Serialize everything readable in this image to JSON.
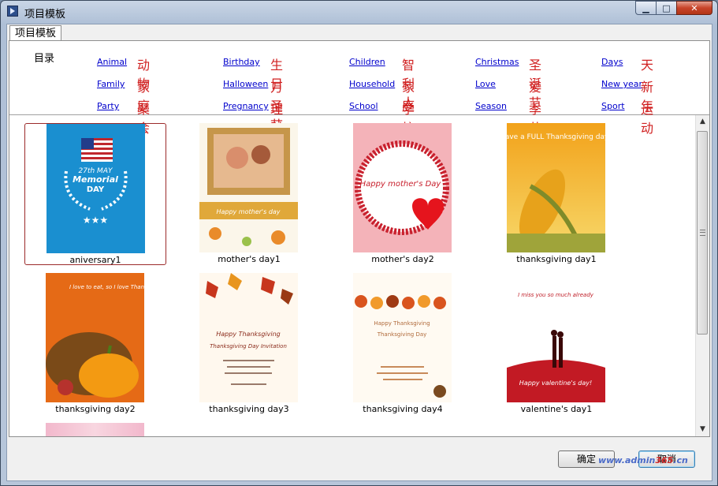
{
  "window": {
    "title": "项目模板",
    "minimize": "▁",
    "maximize": "□",
    "close": "✕"
  },
  "tab": {
    "label": "项目模板"
  },
  "categories": {
    "title": "目录",
    "items": [
      {
        "en": "Animal",
        "zh": "动物"
      },
      {
        "en": "Birthday",
        "zh": "生日"
      },
      {
        "en": "Children",
        "zh": "智利人"
      },
      {
        "en": "Christmas",
        "zh": "圣诞节"
      },
      {
        "en": "Days",
        "zh": "天"
      },
      {
        "en": "Family",
        "zh": "家庭"
      },
      {
        "en": "Halloween",
        "zh": "万圣节"
      },
      {
        "en": "Household",
        "zh": "家庭"
      },
      {
        "en": "Love",
        "zh": "爱"
      },
      {
        "en": "New year",
        "zh": "新年"
      },
      {
        "en": "Party",
        "zh": "聚会"
      },
      {
        "en": "Pregnancy",
        "zh": "理财"
      },
      {
        "en": "School",
        "zh": "学校"
      },
      {
        "en": "Season",
        "zh": "季节"
      },
      {
        "en": "Sport",
        "zh": "运动"
      }
    ]
  },
  "templates": [
    {
      "name": "aniversary1",
      "selected": true
    },
    {
      "name": "mother's day1",
      "thumb_text": "Happy mother's day"
    },
    {
      "name": "mother's day2",
      "thumb_text": "Happy mother's Day"
    },
    {
      "name": "thanksgiving day1",
      "thumb_text": "Have a FULL Thanksgiving day!"
    },
    {
      "name": "thanksgiving day2",
      "thumb_text": "I love to eat, so I love Thanksgiving"
    },
    {
      "name": "thanksgiving day3",
      "thumb_text": "Happy Thanksgiving"
    },
    {
      "name": "thanksgiving day4",
      "thumb_text": "Happy Thanksgiving"
    },
    {
      "name": "valentine's day1",
      "thumb_text": "Happy valentine's day!"
    }
  ],
  "memorial": {
    "line1": "27th MAY",
    "line2": "Memorial",
    "line3": "DAY"
  },
  "buttons": {
    "ok": "确定",
    "cancel": "取消"
  },
  "watermark": {
    "a": "www.admin",
    "b": "365",
    "c": ".cn"
  }
}
